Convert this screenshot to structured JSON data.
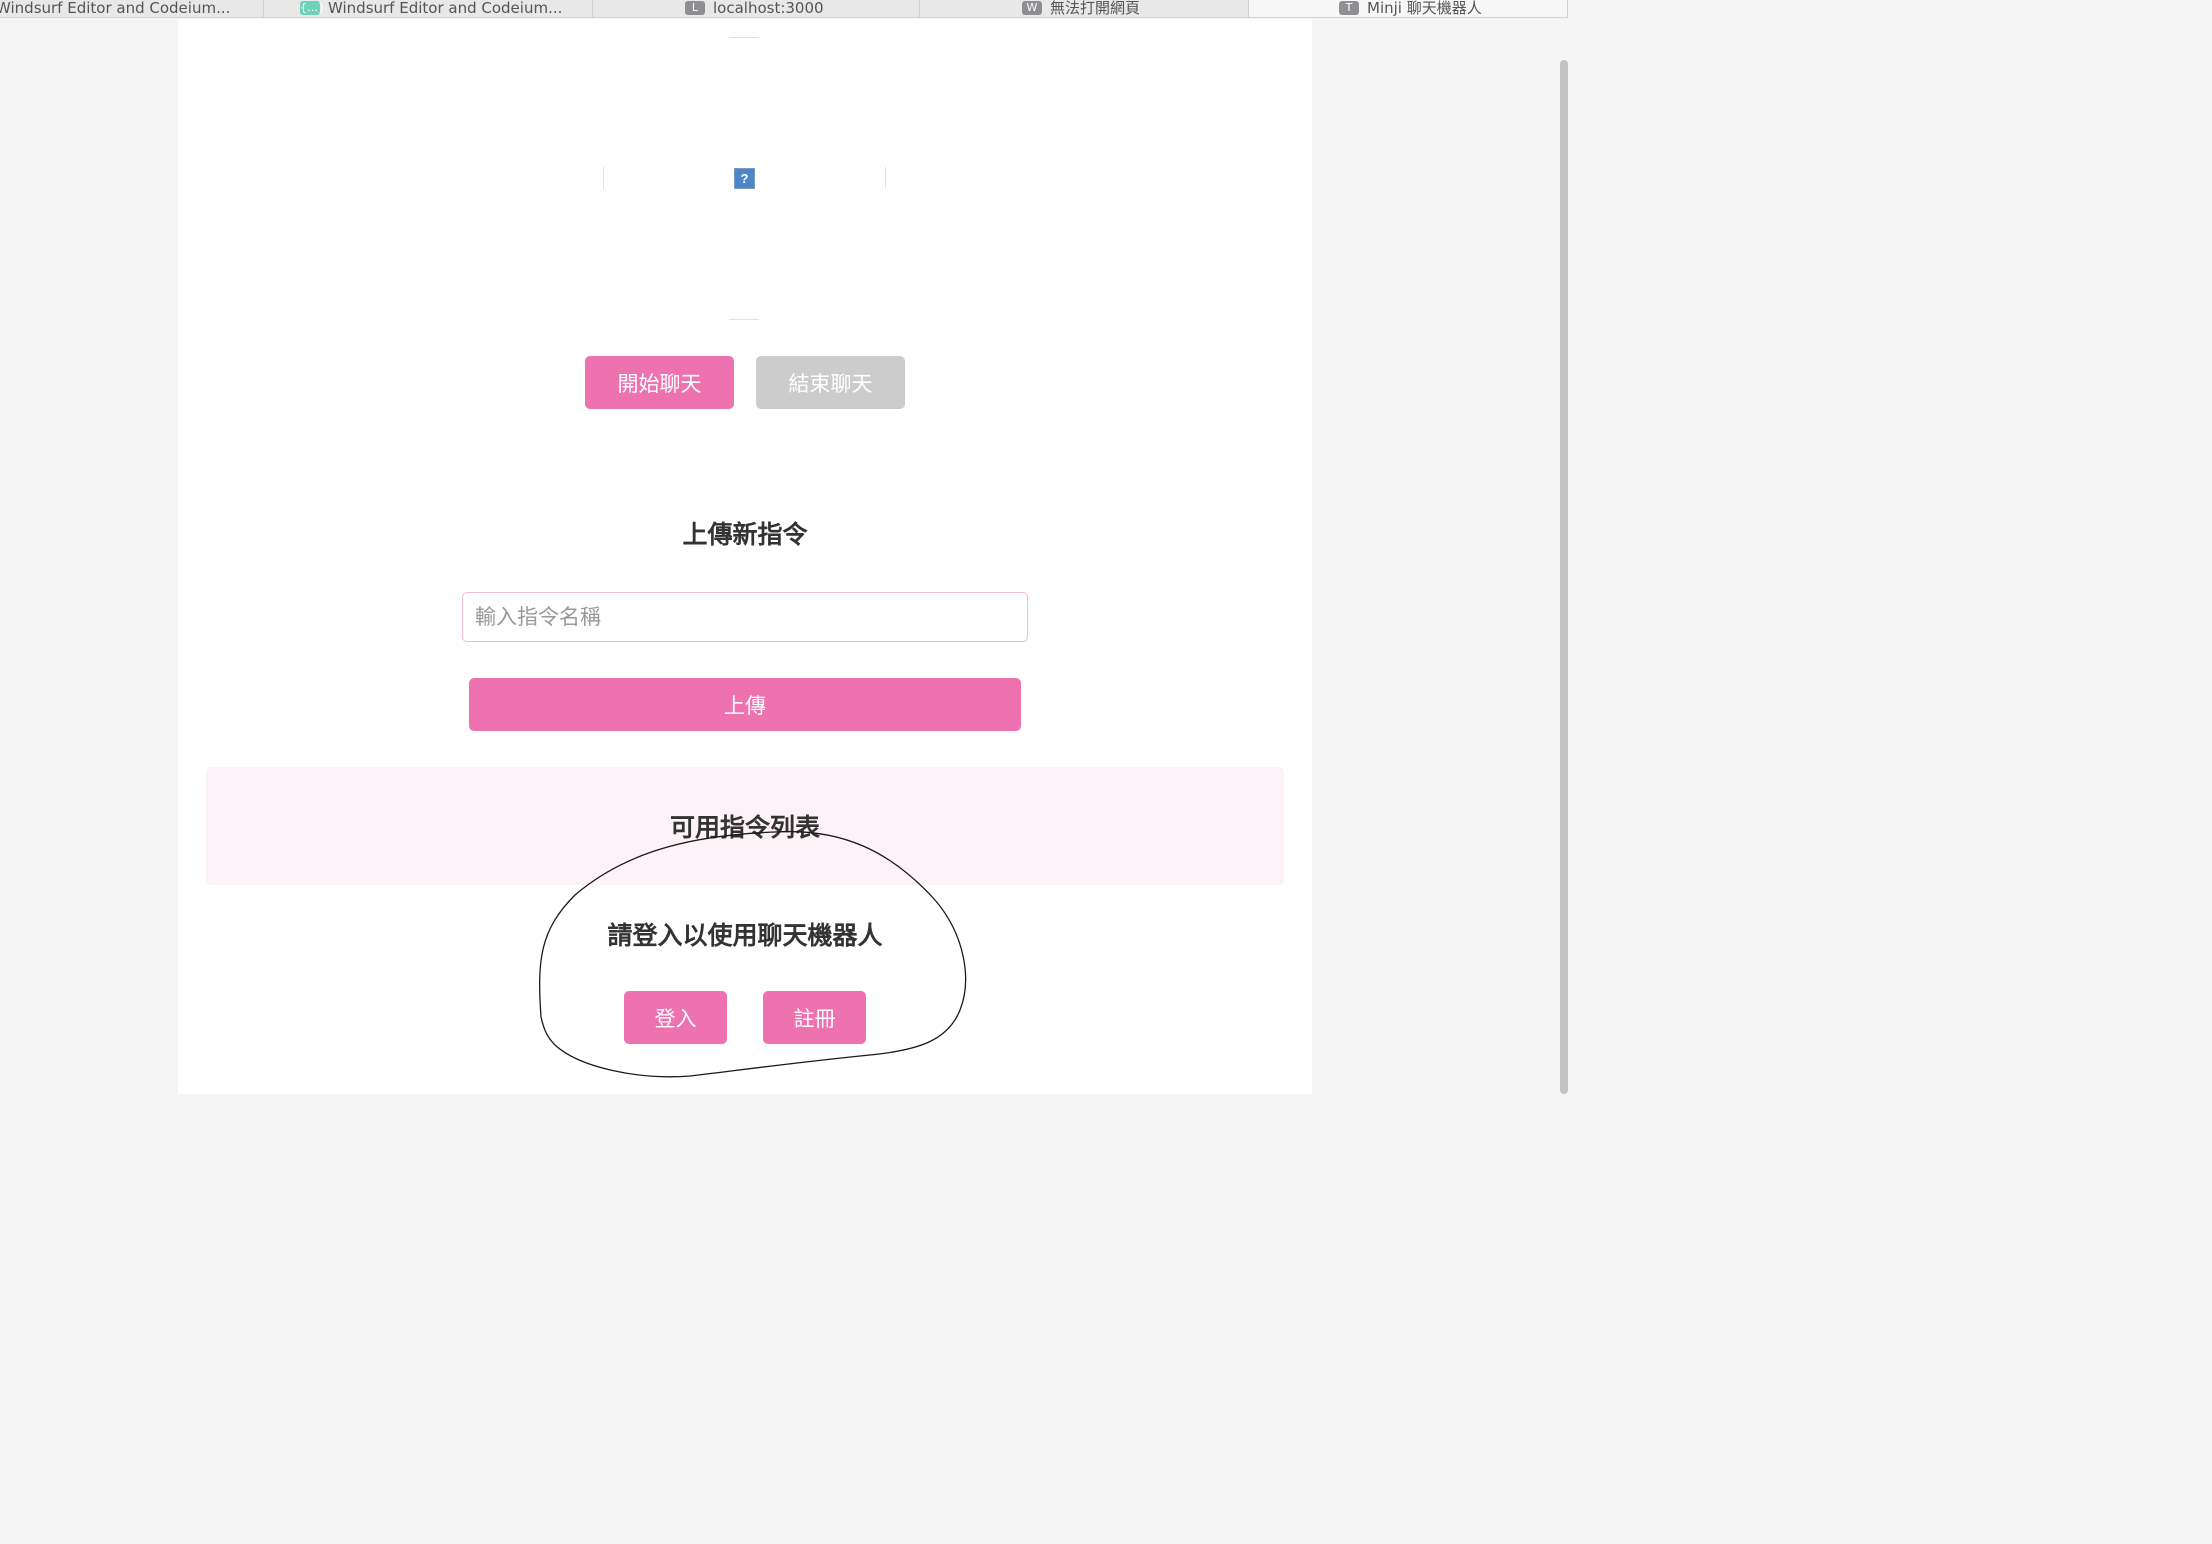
{
  "tabs": [
    {
      "label": "Windsurf Editor and Codeium...",
      "favicon": "",
      "active": false
    },
    {
      "label": "Windsurf Editor and Codeium...",
      "favicon": "{…}",
      "active": false
    },
    {
      "label": "localhost:3000",
      "favicon": "L",
      "active": false
    },
    {
      "label": "無法打開網頁",
      "favicon": "W",
      "active": false
    },
    {
      "label": "Minji 聊天機器人",
      "favicon": "T",
      "active": true
    }
  ],
  "video": {
    "broken_icon": "?"
  },
  "chat_controls": {
    "start_label": "開始聊天",
    "end_label": "結束聊天"
  },
  "upload": {
    "heading": "上傳新指令",
    "input_placeholder": "輸入指令名稱",
    "input_value": "",
    "button_label": "上傳"
  },
  "command_list": {
    "title": "可用指令列表"
  },
  "auth": {
    "prompt": "請登入以使用聊天機器人",
    "login_label": "登入",
    "register_label": "註冊"
  },
  "colors": {
    "accent": "#ee72b0",
    "disabled": "#cccccc",
    "panel_bg": "#fdf2f7",
    "input_border": "#f2bcd6"
  }
}
